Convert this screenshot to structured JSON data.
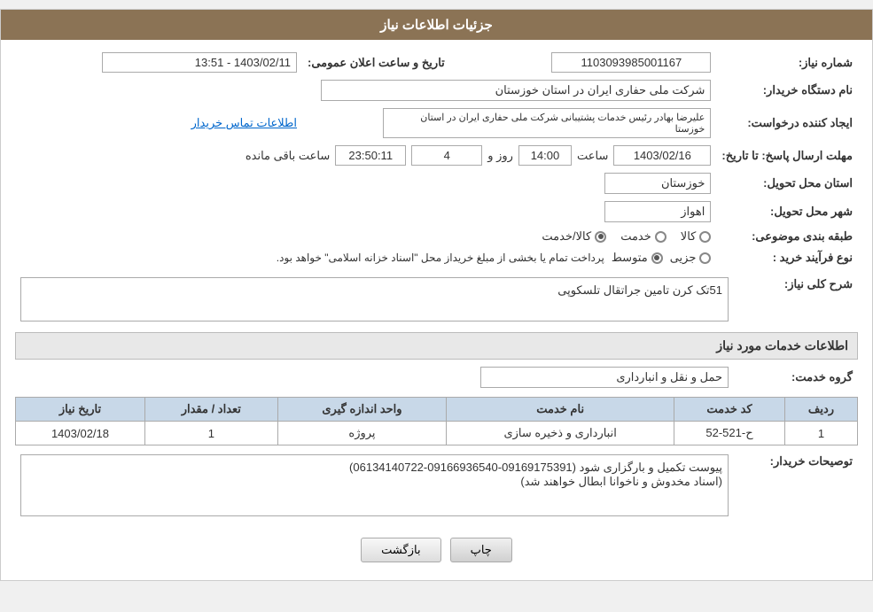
{
  "page": {
    "title": "جزئیات اطلاعات نیاز"
  },
  "fields": {
    "shomareNiaz_label": "شماره نیاز:",
    "shomareNiaz_value": "1103093985001167",
    "namDastgah_label": "نام دستگاه خریدار:",
    "namDastgah_value": "شرکت ملی حفاری ایران در استان خوزستان",
    "tarikh_label": "تاریخ و ساعت اعلان عمومی:",
    "tarikh_value": "1403/02/11 - 13:51",
    "ijadKarandeh_label": "ایجاد کننده درخواست:",
    "ijadKarandeh_value": "علیرضا بهادر رئیس خدمات پشتیبانی شرکت ملی حفاری ایران در استان خوزستا",
    "ettelaatTamas_link": "اطلاعات تماس خریدار",
    "mohlatErsalPasokh_label": "مهلت ارسال پاسخ: تا تاریخ:",
    "mohlatDate_value": "1403/02/16",
    "mohlatSaat_label": "ساعت",
    "mohlatSaat_value": "14:00",
    "mohlatRooz_label": "روز و",
    "mohlatRooz_value": "4",
    "mohlatMande_label": "ساعت باقی مانده",
    "mohlatMande_value": "23:50:11",
    "ostan_label": "استان محل تحویل:",
    "ostan_value": "خوزستان",
    "shahr_label": "شهر محل تحویل:",
    "shahr_value": "اهواز",
    "tabaqeBandi_label": "طبقه بندی موضوعی:",
    "tabaqe_options": [
      {
        "label": "کالا",
        "selected": false
      },
      {
        "label": "خدمت",
        "selected": false
      },
      {
        "label": "کالا/خدمت",
        "selected": true
      }
    ],
    "noeFarayand_label": "نوع فرآیند خرید :",
    "noeFarayand_options": [
      {
        "label": "جزیی",
        "selected": false
      },
      {
        "label": "متوسط",
        "selected": true
      }
    ],
    "noeFarayand_note": "پرداخت تمام یا بخشی از مبلغ خریداز محل \"اسناد خزانه اسلامی\" خواهد بود.",
    "sharhKolli_label": "شرح کلی نیاز:",
    "sharhKolli_value": "51تک کرن تامین جراتقال تلسکوپی",
    "khadamat_section": "اطلاعات خدمات مورد نیاز",
    "grouhKhedmat_label": "گروه خدمت:",
    "grouhKhedmat_value": "حمل و نقل و انبارداری",
    "table": {
      "headers": [
        "ردیف",
        "کد خدمت",
        "نام خدمت",
        "واحد اندازه گیری",
        "تعداد / مقدار",
        "تاریخ نیاز"
      ],
      "rows": [
        {
          "radif": "1",
          "kodKhedmat": "ح-521-52",
          "namKhedmat": "انبارداری و ذخیره سازی",
          "vahedAndaze": "پروژه",
          "tedad": "1",
          "tarikhNiaz": "1403/02/18"
        }
      ]
    },
    "tosifKharidar_label": "توصیحات خریدار:",
    "tosifKharidar_value": "پیوست تکمیل و بارگزاری شود (09169175391-09166936540-06134140722)\n(اسناد مخدوش و ناخوانا ابطال خواهند شد)",
    "buttons": {
      "chap_label": "چاپ",
      "bazgasht_label": "بازگشت"
    }
  }
}
